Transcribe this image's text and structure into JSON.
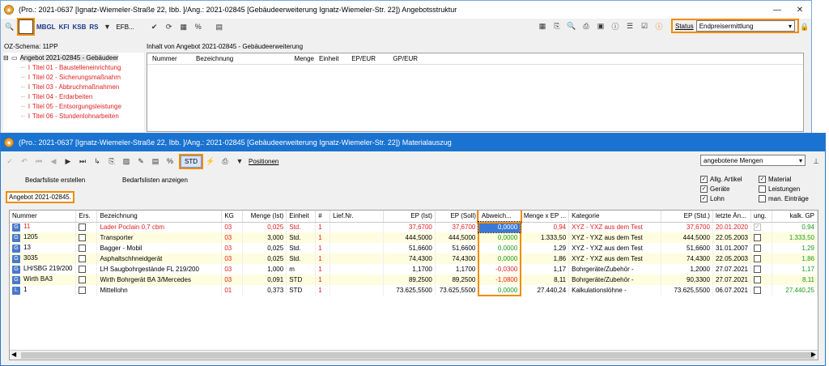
{
  "top_window": {
    "title": "(Pro.: 2021-0637 [Ignatz-Wiemeler-Straße 22, Ibb. ]/Ang.: 2021-02845 [Gebäudeerweiterung Ignatz-Wiemeler-Str. 22]) Angebotsstruktur",
    "toolbar": {
      "mbgl": "MBGL",
      "kfi": "KFI",
      "ksb": "KSB",
      "rs": "RS",
      "efb": "EFB...",
      "percent": "%"
    },
    "status_label": "Status",
    "status_value": "Endpreisermittlung",
    "oz_schema": "OZ-Schema: 11PP",
    "content_header": "Inhalt von Angebot 2021-02845 - Gebäudeerweiterung",
    "columns": [
      "Nummer",
      "Bezeichnung",
      "Menge",
      "Einheit",
      "EP/EUR",
      "GP/EUR"
    ],
    "tree": {
      "root": "Angebot 2021-02845 - Gebäudeer",
      "items": [
        "Titel 01 - Baustelleneinrichtung",
        "Titel 02 - Sicherungsmaßnahm",
        "Titel 03 - Abbruchmaßnahmen",
        "Titel 04 - Erdarbeiten",
        "Titel 05 - Entsorgungsleistunge",
        "Titel 06 - Stundenlohnarbeiten"
      ]
    }
  },
  "bottom_window": {
    "title": "(Pro.: 2021-0637 [Ignatz-Wiemeler-Straße 22, Ibb. ]/Ang.: 2021-02845 [Gebäudeerweiterung Ignatz-Wiemeler-Str. 22]) Materialauszug",
    "std_label": "STD",
    "positionen_label": "Positionen",
    "bedarfsliste_erstellen": "Bedarfsliste erstellen",
    "bedarfslisten_anzeigen": "Bedarfslisten anzeigen",
    "angebot_label": "Angebot 2021-02845.",
    "dropdown_value": "angebotene Mengen",
    "checkboxes": [
      {
        "label": "Allg. Artikel",
        "checked": true
      },
      {
        "label": "Material",
        "checked": true
      },
      {
        "label": "Geräte",
        "checked": true
      },
      {
        "label": "Leistungen",
        "checked": false
      },
      {
        "label": "Lohn",
        "checked": true
      },
      {
        "label": "man. Einträge",
        "checked": false
      }
    ],
    "columns": [
      "Nummer",
      "Ers.",
      "Bezeichnung",
      "KG",
      "Menge (Ist)",
      "Einheit",
      "#",
      "Lief.Nr.",
      "EP (Ist)",
      "EP (Soll)",
      "Abweich...",
      "Menge x EP ...",
      "Kategorie",
      "EP (Std.)",
      "letzte Än...",
      "ung.",
      "kalk. GP"
    ],
    "rows": [
      {
        "icon": "G",
        "nummer": "11",
        "bez": "Lader Poclain 0,7 cbm",
        "kg": "03",
        "menge": "0,025",
        "einheit": "Std.",
        "hash": "1",
        "lief": "",
        "ep_ist": "37,6700",
        "ep_soll": "37,6700",
        "abw": "0,0000",
        "mxe": "0,94",
        "kat": "XYZ - YXZ aus dem Test",
        "ep_std": "37,6700",
        "date": "20.01.2020",
        "ung": true,
        "kalk": "0,94",
        "red": true,
        "abw_color": "selected"
      },
      {
        "icon": "G",
        "nummer": "1205",
        "bez": "Transporter",
        "kg": "03",
        "menge": "3,000",
        "einheit": "Std.",
        "hash": "1",
        "lief": "",
        "ep_ist": "444,5000",
        "ep_soll": "444,5000",
        "abw": "0,0000",
        "mxe": "1.333,50",
        "kat": "XYZ - YXZ aus dem Test",
        "ep_std": "444,5000",
        "date": "22.05.2003",
        "ung": false,
        "kalk": "1.333,50",
        "red": false,
        "abw_color": "green"
      },
      {
        "icon": "G",
        "nummer": "13",
        "bez": "Bagger - Mobil",
        "kg": "03",
        "menge": "0,025",
        "einheit": "Std.",
        "hash": "1",
        "lief": "",
        "ep_ist": "51,6600",
        "ep_soll": "51,6600",
        "abw": "0,0000",
        "mxe": "1,29",
        "kat": "XYZ - YXZ aus dem Test",
        "ep_std": "51,6600",
        "date": "31.01.2007",
        "ung": false,
        "kalk": "1,29",
        "red": false,
        "abw_color": "green"
      },
      {
        "icon": "G",
        "nummer": "3035",
        "bez": "Asphaltschhneidgerät",
        "kg": "03",
        "menge": "0,025",
        "einheit": "Std.",
        "hash": "1",
        "lief": "",
        "ep_ist": "74,4300",
        "ep_soll": "74,4300",
        "abw": "0,0000",
        "mxe": "1,86",
        "kat": "XYZ - YXZ aus dem Test",
        "ep_std": "74,4300",
        "date": "22.05.2003",
        "ung": false,
        "kalk": "1,86",
        "red": false,
        "abw_color": "green"
      },
      {
        "icon": "G",
        "nummer": "LH/SBG 219/200",
        "bez": "LH Saugbohrgestände FL 219/200",
        "kg": "03",
        "menge": "1,000",
        "einheit": "m",
        "hash": "1",
        "lief": "",
        "ep_ist": "1,1700",
        "ep_soll": "1,1700",
        "abw": "-0,0300",
        "mxe": "1,17",
        "kat": "Bohrgeräte/Zubehör -",
        "ep_std": "1,2000",
        "date": "27.07.2021",
        "ung": false,
        "kalk": "1,17",
        "red": false,
        "abw_color": "red"
      },
      {
        "icon": "G",
        "nummer": "Wirth BA3",
        "bez": "Wirth Bohrgerät  BA 3/Mercedes",
        "kg": "03",
        "menge": "0,091",
        "einheit": "STD",
        "hash": "1",
        "lief": "",
        "ep_ist": "89,2500",
        "ep_soll": "89,2500",
        "abw": "-1,0800",
        "mxe": "8,11",
        "kat": "Bohrgeräte/Zubehör -",
        "ep_std": "90,3300",
        "date": "27.07.2021",
        "ung": false,
        "kalk": "8,11",
        "red": false,
        "abw_color": "red"
      },
      {
        "icon": "L",
        "nummer": "1",
        "bez": "Mittellohn",
        "kg": "01",
        "menge": "0,373",
        "einheit": "STD",
        "hash": "1",
        "lief": "",
        "ep_ist": "73.625,5500",
        "ep_soll": "73.625,5500",
        "abw": "0,0000",
        "mxe": "27.440,24",
        "kat": "Kalkulationslöhne -",
        "ep_std": "73.625,5500",
        "date": "06.07.2021",
        "ung": false,
        "kalk": "27.440,25",
        "red": false,
        "abw_color": "green"
      }
    ]
  }
}
